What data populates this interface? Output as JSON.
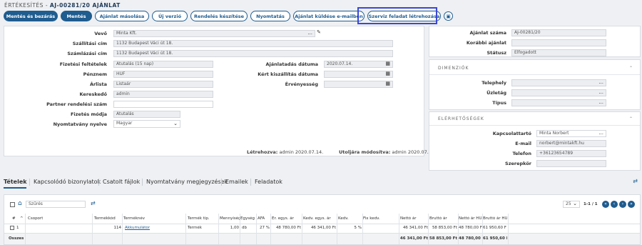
{
  "breadcrumb": {
    "section": "ÉRTÉKESÍTÉS",
    "title": "AJ-00281/20 AJÁNLAT"
  },
  "toolbar": {
    "save_close": "Mentés és bezárás",
    "save": "Mentés",
    "copy_offer": "Ajánlat másolása",
    "new_version": "Új verzió",
    "create_order": "Rendelés készítése",
    "print": "Nyomtatás",
    "send_email": "Ajánlat küldése e-mailben",
    "create_service": "Szerviz feladat létrehozása"
  },
  "form": {
    "customer_label": "Vevő",
    "customer": "Minta Kft.",
    "shipping_label": "Szállítási cím",
    "shipping": "1132 Budapest Váci út 18.",
    "billing_label": "Számlázási cím",
    "billing": "1132 Budapest Váci út 18.",
    "payment_terms_label": "Fizetési feltételek",
    "payment_terms": "Átutalás (15 nap)",
    "currency_label": "Pénznem",
    "currency": "HUF",
    "pricelist_label": "Árlista",
    "pricelist": "Listaár",
    "salesperson_label": "Kereskedő",
    "salesperson": "admin",
    "partner_order_label": "Partner rendelési szám",
    "partner_order": "",
    "payment_method_label": "Fizetés módja",
    "payment_method": "Átutalás",
    "print_lang_label": "Nyomtatvány nyelve",
    "print_lang": "Magyar",
    "offer_date_label": "Ajánlatadás dátuma",
    "offer_date": "2020.07.14.",
    "requested_date_label": "Kért kiszállítás dátuma",
    "requested_date": "",
    "validity_label": "Érvényesség",
    "validity": "",
    "created_label": "Létrehozva:",
    "created": "admin 2020.07.14.",
    "modified_label": "Utoljára módosítva:",
    "modified": "admin 2020.07.14."
  },
  "right": {
    "offer_no_label": "Ajánlat száma",
    "offer_no": "AJ-00281/20",
    "prev_offer_label": "Korábbi ajánlat",
    "prev_offer": "",
    "status_label": "Státusz",
    "status": "Elfogadott",
    "dimensions_title": "DIMENZIÓK",
    "site_label": "Telephely",
    "branch_label": "Üzletág",
    "type_label": "Típus",
    "contacts_title": "ELÉRHETŐSÉGEK",
    "contact_label": "Kapcsolattartó",
    "contact": "Minta Norbert",
    "email_label": "E-mail",
    "email": "norbert@mintakft.hu",
    "phone_label": "Telefon",
    "phone": "+36123654789",
    "role_label": "Szerepkör",
    "role": ""
  },
  "tabs": [
    "Tételek",
    "Kapcsolódó bizonylatok",
    "Csatolt fájlok",
    "Nyomtatvány megjegyzések",
    "Emailek",
    "Feladatok"
  ],
  "grid": {
    "filter_placeholder": "Szűrés",
    "page_size": "25",
    "page_info": "1-1 / 1",
    "headers": [
      "#",
      "Csoport",
      "Termékkód",
      "Terméknév",
      "Termék típ.",
      "Mennyiség",
      "Egység",
      "ÁFA",
      "Er. egys. ár",
      "Kedv. egys. ár",
      "Kedv.",
      "Fix kedv.",
      "Nettó ár",
      "Bruttó ár",
      "Nettó ár HUF",
      "Bruttó ár HUF"
    ],
    "row": {
      "num": "1",
      "group": "",
      "code": "114",
      "name": "Akkumulátor",
      "type": "Termék",
      "qty": "1,00",
      "unit": "db",
      "vat": "27 %",
      "orig_price": "48 780,00 Ft",
      "disc_price": "46 341,00 Ft",
      "disc": "5 %",
      "fix_disc": "",
      "net": "46 341,00 Ft",
      "gross": "58 853,00 Ft",
      "net_huf": "48 780,00 F",
      "gross_huf": "61 950,60 F"
    },
    "total": {
      "label": "Összes",
      "net": "46 341,00 Ft",
      "gross": "58 853,00 Ft",
      "net_huf": "48 780,00 F",
      "gross_huf": "61 950,60 F"
    }
  },
  "colors": {
    "primary": "#1f5c8f",
    "highlight": "#3b48d6"
  }
}
